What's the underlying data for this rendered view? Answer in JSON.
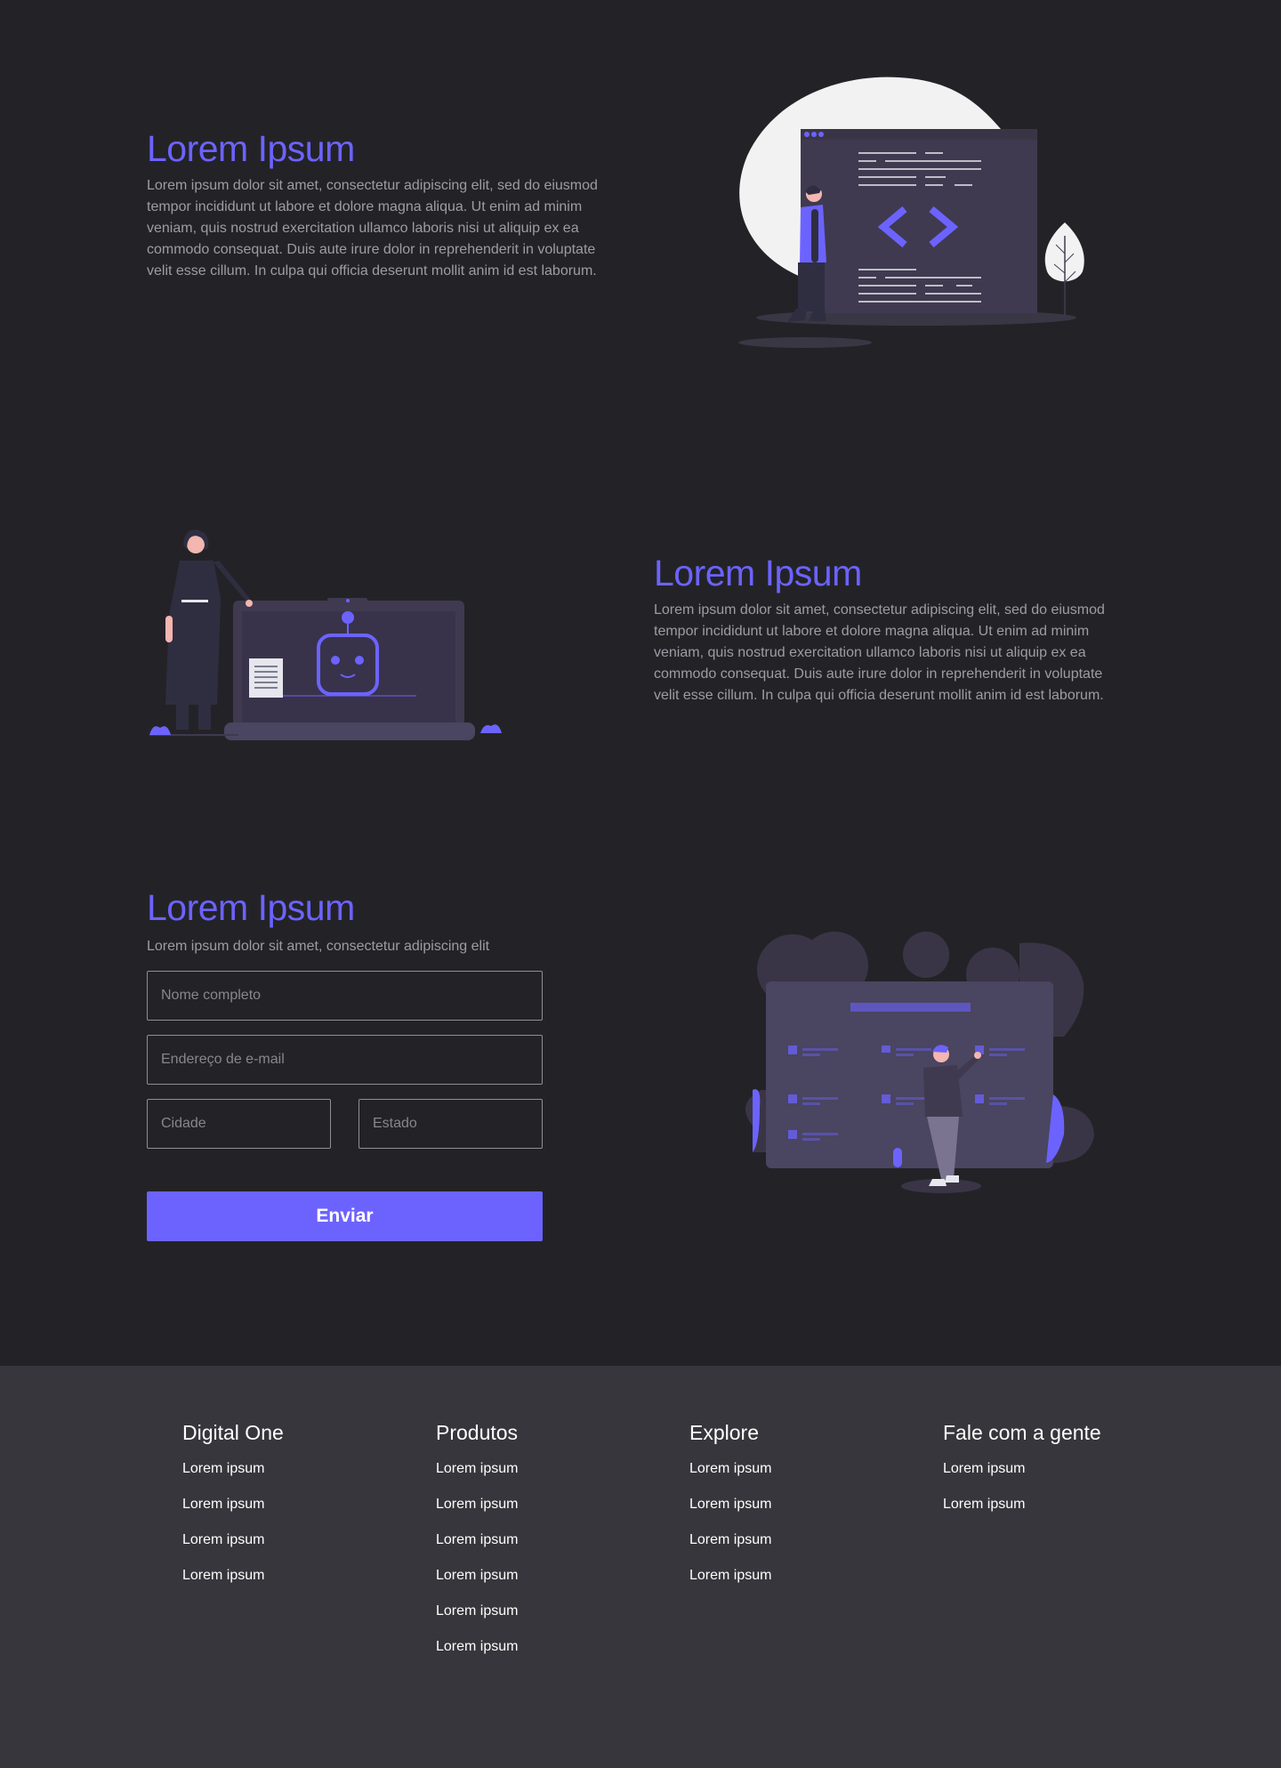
{
  "section1": {
    "title": "Lorem Ipsum",
    "text": "Lorem ipsum dolor sit amet, consectetur adipiscing elit, sed do eiusmod tempor incididunt ut labore et dolore magna aliqua. Ut enim ad minim veniam, quis nostrud exercitation ullamco laboris nisi ut aliquip ex ea commodo consequat. Duis aute irure dolor in reprehenderit in voluptate velit esse cillum. In culpa qui officia deserunt mollit anim id est laborum.",
    "illustration": "developer-code-window-illustration"
  },
  "section2": {
    "title": "Lorem Ipsum",
    "text": "Lorem ipsum dolor sit amet, consectetur adipiscing elit, sed do eiusmod tempor incididunt ut labore et dolore magna aliqua. Ut enim ad minim veniam, quis nostrud exercitation ullamco laboris nisi ut aliquip ex ea commodo consequat. Duis aute irure dolor in reprehenderit in voluptate velit esse cillum. In culpa qui officia deserunt mollit anim id est laborum.",
    "illustration": "woman-robot-laptop-illustration"
  },
  "section3": {
    "title": "Lorem Ipsum",
    "subtitle": "Lorem ipsum dolor sit amet, consectetur adipiscing elit",
    "form": {
      "name_placeholder": "Nome completo",
      "email_placeholder": "Endereço de e-mail",
      "city_placeholder": "Cidade",
      "state_placeholder": "Estado",
      "submit_label": "Enviar"
    },
    "illustration": "person-dashboard-illustration"
  },
  "colors": {
    "background": "#232327",
    "accent": "#6c63ff",
    "footer_background": "#36363c"
  },
  "footer": {
    "columns": [
      {
        "title": "Digital One",
        "links": [
          "Lorem ipsum",
          "Lorem ipsum",
          "Lorem ipsum",
          "Lorem ipsum"
        ]
      },
      {
        "title": "Produtos",
        "links": [
          "Lorem ipsum",
          "Lorem ipsum",
          "Lorem ipsum",
          "Lorem ipsum",
          "Lorem ipsum",
          "Lorem ipsum"
        ]
      },
      {
        "title": "Explore",
        "links": [
          "Lorem ipsum",
          "Lorem ipsum",
          "Lorem ipsum",
          "Lorem ipsum"
        ]
      },
      {
        "title": "Fale com a gente",
        "links": [
          "Lorem ipsum",
          "Lorem ipsum"
        ]
      }
    ]
  }
}
